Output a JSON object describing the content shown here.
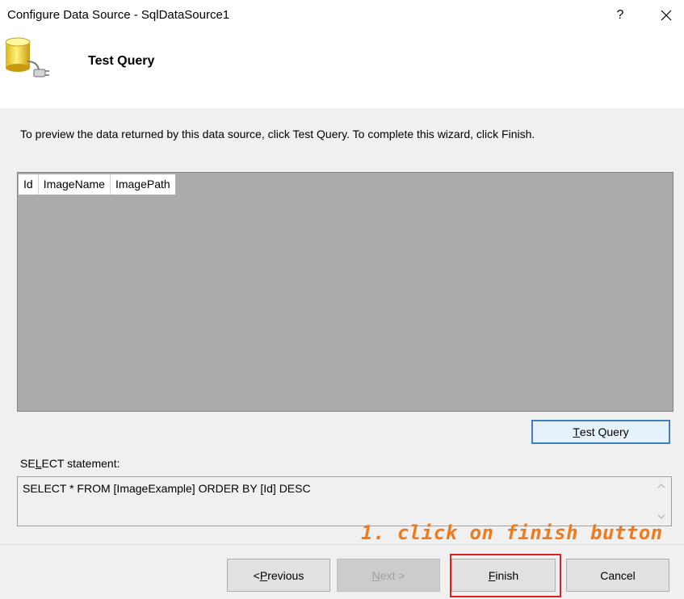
{
  "window": {
    "title": "Configure Data Source - SqlDataSource1",
    "help_label": "?",
    "close_label": "×"
  },
  "header": {
    "title": "Test Query",
    "icon": "database-plug-icon"
  },
  "instruction": "To preview the data returned by this data source, click Test Query. To complete this wizard, click Finish.",
  "results": {
    "columns": [
      "Id",
      "ImageName",
      "ImagePath"
    ]
  },
  "test_query_button": {
    "accel": "T",
    "rest": "est Query"
  },
  "select_statement": {
    "label_pre": "SE",
    "label_accel": "L",
    "label_post": "ECT statement:",
    "value": "SELECT * FROM [ImageExample] ORDER BY [Id] DESC"
  },
  "annotation": "1. click on finish button",
  "buttons": {
    "previous": {
      "pre": "< ",
      "accel": "P",
      "rest": "revious"
    },
    "next": {
      "accel": "N",
      "rest": "ext >"
    },
    "finish": {
      "accel": "F",
      "rest": "inish"
    },
    "cancel": "Cancel"
  },
  "colors": {
    "annotation": "#f07a1a",
    "highlight": "#e02020",
    "focus_border": "#3f7fc5",
    "grid_background": "#ababab"
  }
}
